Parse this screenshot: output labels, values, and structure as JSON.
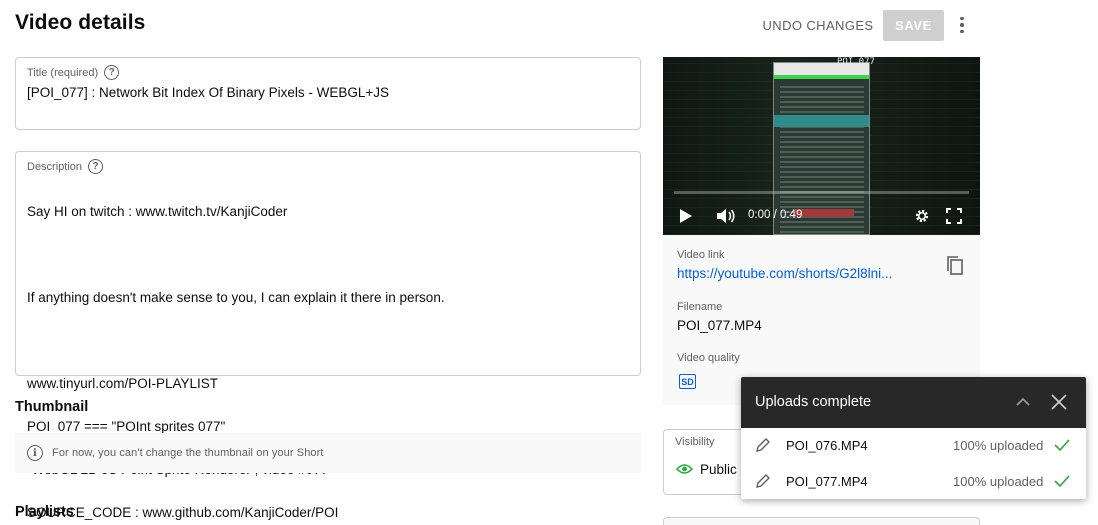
{
  "header": {
    "title": "Video details",
    "undo_label": "UNDO CHANGES",
    "save_label": "SAVE",
    "menu_icon": "more-vert-icon"
  },
  "title_field": {
    "label": "Title (required)",
    "value": "[POI_077] : Network Bit Index Of Binary Pixels - WEBGL+JS"
  },
  "description_field": {
    "label": "Description",
    "lines": [
      "Say HI on twitch : www.twitch.tv/KanjiCoder",
      "",
      "If anything doesn't make sense to you, I can explain it there in person.",
      "",
      "www.tinyurl.com/POI-PLAYLIST",
      "POI_077 === \"POInt sprites 077\"",
      "\"WebGL 2D JS Point Sprite Renderer , video #077\"",
      "SOURCE_CODE : www.github.com/KanjiCoder/POI"
    ]
  },
  "thumbnail": {
    "heading": "Thumbnail",
    "note": "For now, you can't change the thumbnail on your Short"
  },
  "playlists": {
    "heading": "Playlists"
  },
  "video": {
    "overlay_title": "POI_077",
    "time": "0:00 / 0:49",
    "progress": 0.0
  },
  "video_info": {
    "link_label": "Video link",
    "link_value": "https://youtube.com/shorts/G2l8lni...",
    "filename_label": "Filename",
    "filename_value": "POI_077.MP4",
    "quality_label": "Video quality",
    "quality_badge": "SD"
  },
  "visibility": {
    "label": "Visibility",
    "value": "Public"
  },
  "uploads": {
    "title": "Uploads complete",
    "items": [
      {
        "name": "POI_076.MP4",
        "status": "100% uploaded"
      },
      {
        "name": "POI_077.MP4",
        "status": "100% uploaded"
      }
    ]
  },
  "colors": {
    "accent_link": "#065fd4",
    "success": "#2ba640",
    "save_disabled": "#cfcfcf",
    "toast_header": "#282828"
  }
}
